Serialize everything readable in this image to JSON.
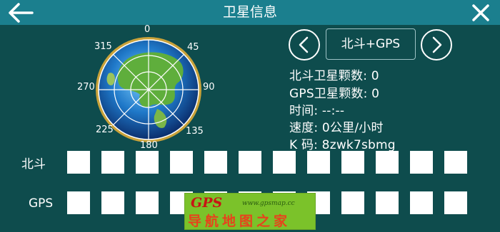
{
  "header": {
    "title": "卫星信息"
  },
  "compass": {
    "labels": [
      "0",
      "45",
      "90",
      "135",
      "180",
      "225",
      "270",
      "315"
    ]
  },
  "system_selector": {
    "current": "北斗+GPS"
  },
  "info": {
    "beidou_count": "北斗卫星颗数: 0",
    "gps_count": "GPS卫星颗数: 0",
    "time": "时间: --:--",
    "speed": "速度: 0公里/小时",
    "code": "K 码: 8zwk7sbmg"
  },
  "rows": {
    "beidou_label": "北斗",
    "gps_label": "GPS"
  },
  "watermark": {
    "brand": "GPS",
    "url": "www.gpsmap.cc",
    "text": "导航地图之家"
  },
  "colors": {
    "background": "#0e4c4d",
    "header": "#1b7f8e",
    "watermark_bg": "#7bc22a",
    "watermark_text": "#e8421c"
  }
}
